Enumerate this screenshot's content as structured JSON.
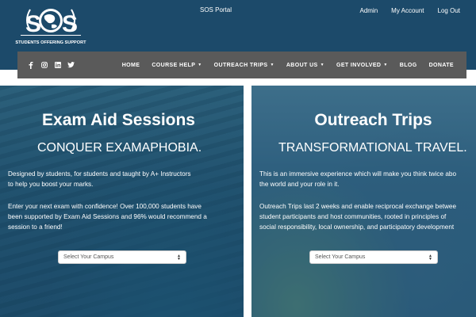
{
  "header": {
    "portal_title": "SOS Portal",
    "logo": {
      "letters": "SOS",
      "tagline": "STUDENTS OFFERING SUPPORT"
    },
    "top_links": [
      "Admin",
      "My Account",
      "Log Out"
    ]
  },
  "navbar": {
    "social": [
      {
        "name": "facebook-icon",
        "glyph": "f"
      },
      {
        "name": "instagram-icon",
        "glyph": "◘"
      },
      {
        "name": "linkedin-icon",
        "glyph": "in"
      },
      {
        "name": "twitter-icon",
        "glyph": "🐦"
      }
    ],
    "items": [
      {
        "label": "HOME",
        "dropdown": false
      },
      {
        "label": "COURSE HELP",
        "dropdown": true
      },
      {
        "label": "OUTREACH TRIPS",
        "dropdown": true
      },
      {
        "label": "ABOUT US",
        "dropdown": true
      },
      {
        "label": "GET INVOLVED",
        "dropdown": true
      },
      {
        "label": "BLOG",
        "dropdown": false
      },
      {
        "label": "DONATE",
        "dropdown": false
      }
    ]
  },
  "panels": {
    "exam": {
      "title": "Exam Aid Sessions",
      "subtitle": "CONQUER EXAMAPHOBIA.",
      "p1": [
        "Designed by students, for students and taught by A+ Instructors",
        "to help you boost your marks."
      ],
      "p2": [
        "Enter your next exam with confidence! Over 100,000 students have",
        "been supported by Exam Aid Sessions and 96% would recommend a",
        "session to a friend!"
      ],
      "select": "Select Your Campus"
    },
    "outreach": {
      "title": "Outreach Trips",
      "subtitle": "TRANSFORMATIONAL TRAVEL.",
      "p1": [
        "This is an immersive experience which will make you think twice abo",
        "the world and your role in it."
      ],
      "p2": [
        "Outreach Trips last 2 weeks and enable reciprocal exchange betwee",
        "student participants and host communities, rooted in principles of",
        "social responsibility, local ownership, and participatory development"
      ],
      "select": "Select Your Campus"
    }
  },
  "colors": {
    "header_bg": "#1c4a6a",
    "nav_bg": "#5a5a5a",
    "text": "#ffffff"
  }
}
